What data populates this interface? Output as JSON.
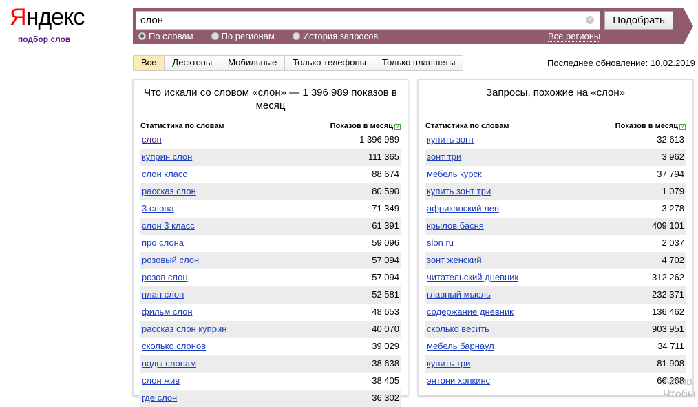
{
  "logo": "Яндекс",
  "sublink": "подбор слов",
  "search": {
    "value": "слон",
    "button": "Подобрать"
  },
  "radios": [
    {
      "label": "По словам",
      "checked": true
    },
    {
      "label": "По регионам",
      "checked": false
    },
    {
      "label": "История запросов",
      "checked": false
    }
  ],
  "regions": "Все регионы",
  "tabs": [
    {
      "label": "Все",
      "active": true
    },
    {
      "label": "Десктопы"
    },
    {
      "label": "Мобильные"
    },
    {
      "label": "Только телефоны"
    },
    {
      "label": "Только планшеты"
    }
  ],
  "updated": "Последнее обновление: 10.02.2019",
  "left": {
    "title": "Что искали со словом «слон» — 1 396 989 показов в месяц",
    "col1": "Статистика по словам",
    "col2": "Показов в месяц",
    "rows": [
      [
        "слон",
        "1 396 989"
      ],
      [
        "куприн слон",
        "111 365"
      ],
      [
        "слон класс",
        "88 674"
      ],
      [
        "рассказ слон",
        "80 590"
      ],
      [
        "3 слона",
        "71 349"
      ],
      [
        "слон 3 класс",
        "61 391"
      ],
      [
        "про слона",
        "59 096"
      ],
      [
        "розовый слон",
        "57 094"
      ],
      [
        "розов слон",
        "57 094"
      ],
      [
        "план слон",
        "52 581"
      ],
      [
        "фильм слон",
        "48 653"
      ],
      [
        "рассказ слон куприн",
        "40 070"
      ],
      [
        "сколько слонов",
        "39 029"
      ],
      [
        "воды слонам",
        "38 638"
      ],
      [
        "слон жив",
        "38 405"
      ],
      [
        "где слон",
        "36 302"
      ]
    ]
  },
  "right": {
    "title": "Запросы, похожие на «слон»",
    "col1": "Статистика по словам",
    "col2": "Показов в месяц",
    "rows": [
      [
        "купить зонт",
        "32 613"
      ],
      [
        "зонт три",
        "3 962"
      ],
      [
        "мебель курск",
        "37 794"
      ],
      [
        "купить зонт три",
        "1 079"
      ],
      [
        "африканский лев",
        "3 278"
      ],
      [
        "крылов басня",
        "409 101"
      ],
      [
        "slon ru",
        "2 037"
      ],
      [
        "зонт женский",
        "4 702"
      ],
      [
        "читательский дневник",
        "312 262"
      ],
      [
        "главный мысль",
        "232 371"
      ],
      [
        "содержание дневник",
        "136 462"
      ],
      [
        "сколько весить",
        "903 951"
      ],
      [
        "мебель барнаул",
        "34 711"
      ],
      [
        "купить три",
        "81 908"
      ],
      [
        "энтони хопкинс",
        "66 268"
      ]
    ]
  },
  "watermark": [
    "Актив",
    "Чтобы"
  ]
}
